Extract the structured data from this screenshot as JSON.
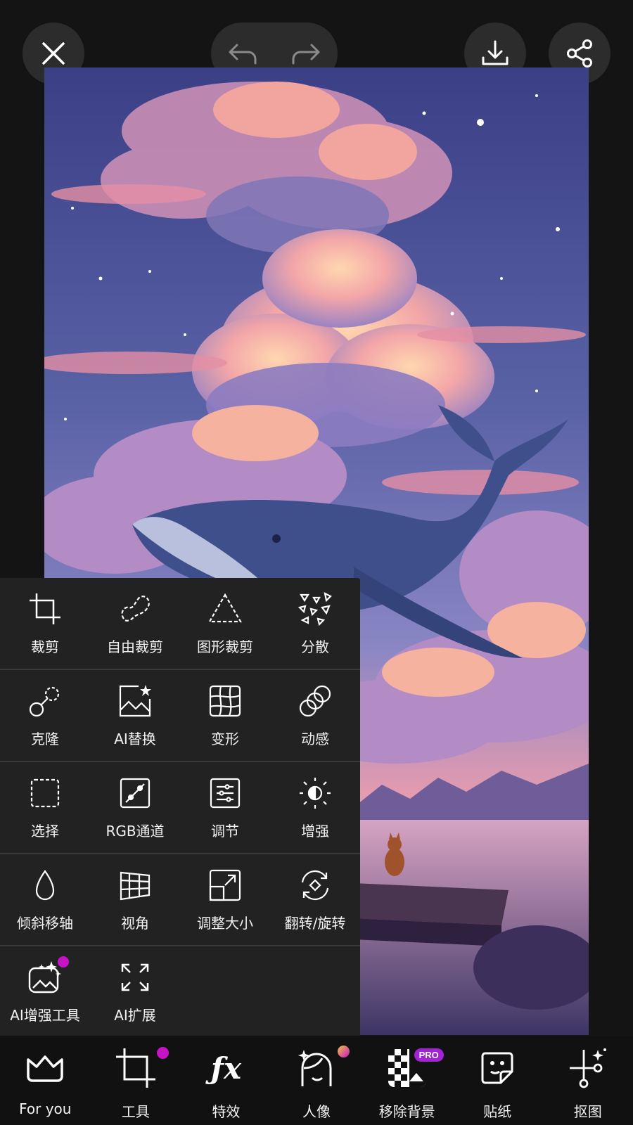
{
  "top_bar": {
    "close_icon": "close-icon",
    "undo_icon": "undo-icon",
    "redo_icon": "redo-icon",
    "download_icon": "download-icon",
    "share_icon": "share-icon"
  },
  "canvas": {
    "description_icon": "whale-sky-illustration"
  },
  "tools": {
    "rows": [
      [
        {
          "label": "裁剪",
          "icon": "crop-icon"
        },
        {
          "label": "自由裁剪",
          "icon": "free-crop-icon"
        },
        {
          "label": "图形裁剪",
          "icon": "shape-crop-icon"
        },
        {
          "label": "分散",
          "icon": "disperse-icon"
        }
      ],
      [
        {
          "label": "克隆",
          "icon": "clone-icon"
        },
        {
          "label": "AI替换",
          "icon": "ai-replace-icon"
        },
        {
          "label": "变形",
          "icon": "warp-icon"
        },
        {
          "label": "动感",
          "icon": "motion-icon"
        }
      ],
      [
        {
          "label": "选择",
          "icon": "select-icon"
        },
        {
          "label": "RGB通道",
          "icon": "rgb-curves-icon"
        },
        {
          "label": "调节",
          "icon": "adjust-icon"
        },
        {
          "label": "增强",
          "icon": "enhance-icon"
        }
      ],
      [
        {
          "label": "倾斜移轴",
          "icon": "tilt-shift-icon"
        },
        {
          "label": "视角",
          "icon": "perspective-icon"
        },
        {
          "label": "调整大小",
          "icon": "resize-icon"
        },
        {
          "label": "翻转/旋转",
          "icon": "flip-rotate-icon"
        }
      ],
      [
        {
          "label": "AI增强工具",
          "icon": "ai-enhance-icon"
        },
        {
          "label": "AI扩展",
          "icon": "ai-expand-icon"
        }
      ]
    ]
  },
  "bottom_nav": {
    "items": [
      {
        "label": "For you",
        "icon": "crown-icon"
      },
      {
        "label": "工具",
        "icon": "crop-tool-icon"
      },
      {
        "label": "特效",
        "icon": "fx-icon"
      },
      {
        "label": "人像",
        "icon": "portrait-icon"
      },
      {
        "label": "移除背景",
        "icon": "remove-bg-icon",
        "badge": "PRO"
      },
      {
        "label": "贴纸",
        "icon": "sticker-icon"
      },
      {
        "label": "抠图",
        "icon": "cutout-icon"
      }
    ]
  },
  "colors": {
    "background": "#141414",
    "panel": "#222222",
    "accent_dot": "#c514c5",
    "pro_badge": "#a322d8"
  }
}
